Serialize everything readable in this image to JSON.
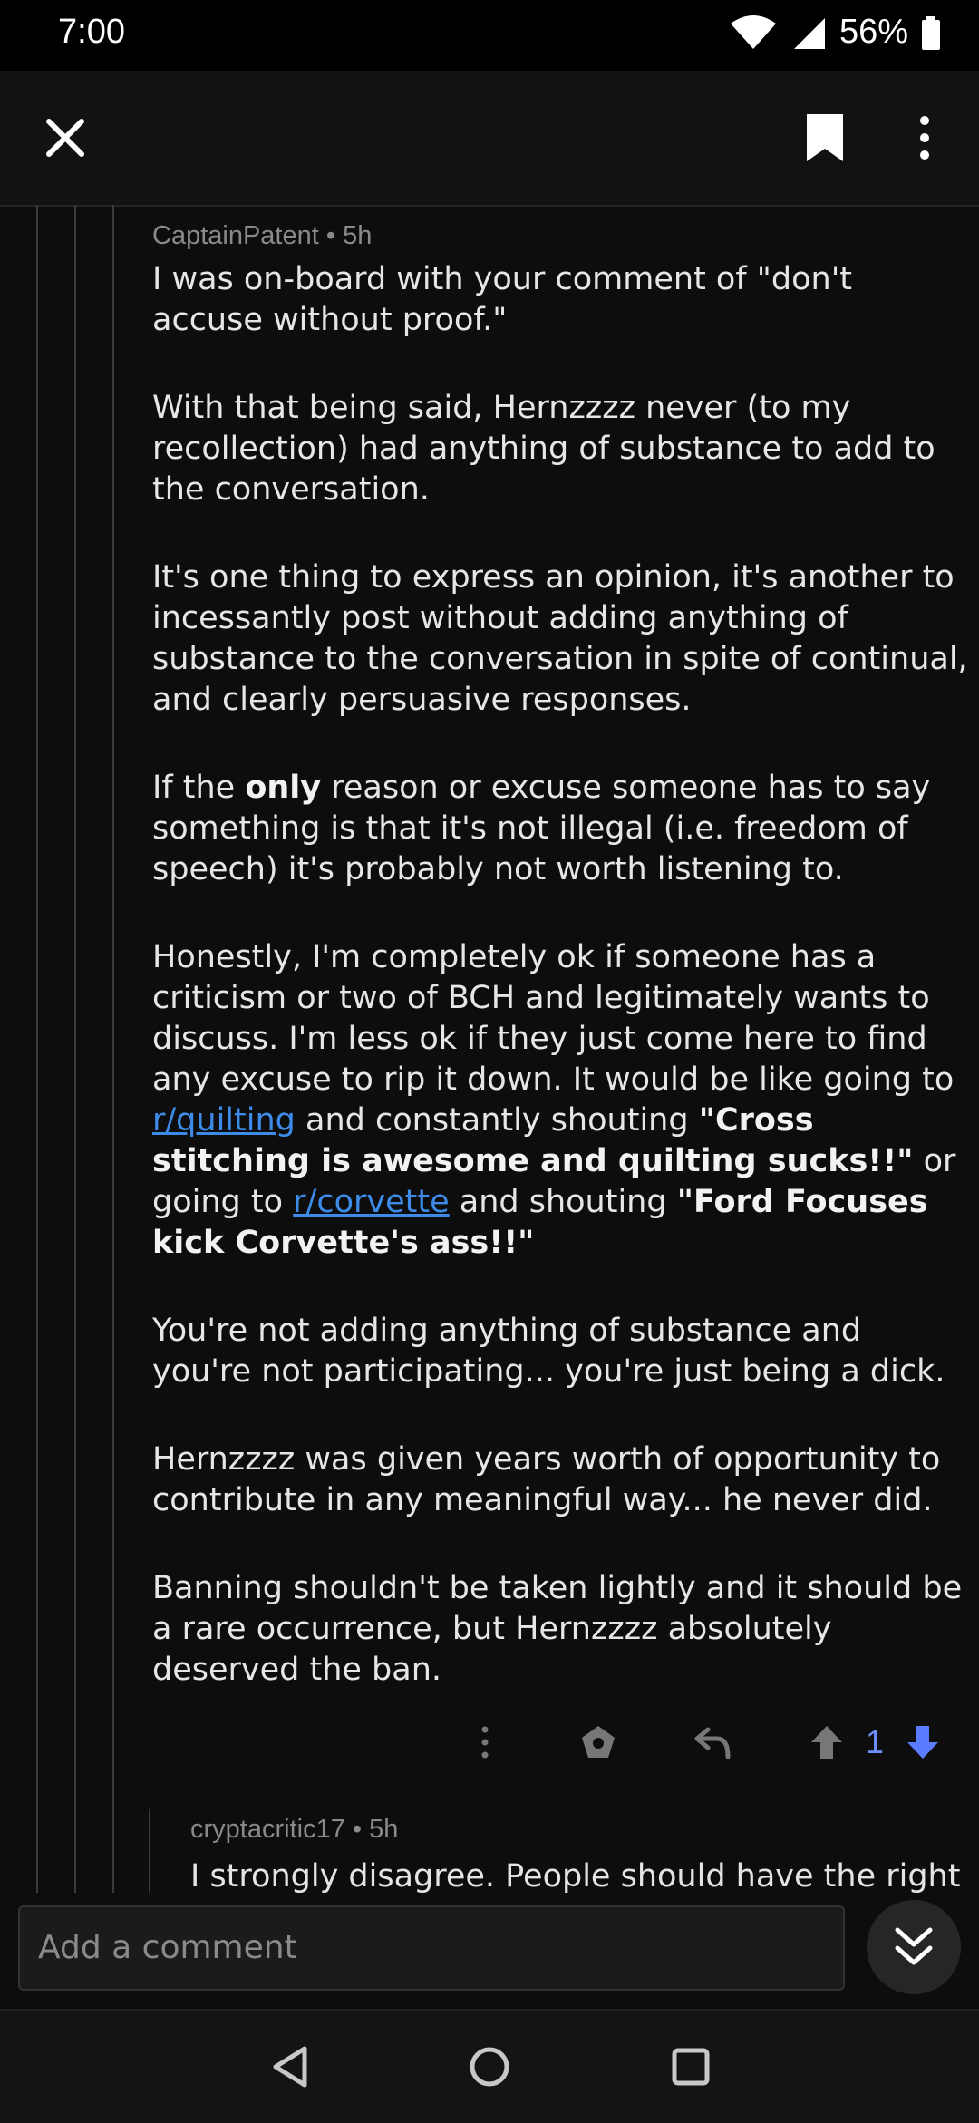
{
  "status_bar": {
    "time": "7:00",
    "battery": "56%"
  },
  "toolbar": {
    "close_icon": "close-icon",
    "bookmark_icon": "bookmark-icon",
    "more_icon": "more-vert-icon"
  },
  "comment": {
    "author": "CaptainPatent",
    "age": "• 5h",
    "p1": "I was on-board with your comment of \"don't accuse without proof.\"",
    "p2": "With that being said, Hernzzzz never (to my recollection) had anything of substance to add to the conversation.",
    "p3": "It's one thing to express an opinion, it's another to incessantly post without adding anything of substance to the conversation in spite of continual, and clearly persuasive responses.",
    "p4_a": "If the ",
    "p4_b": "only",
    "p4_c": " reason or excuse someone has to say something is that it's not illegal (i.e. freedom of speech) it's probably not worth listening to.",
    "p5_a": "Honestly, I'm completely ok if someone has a criticism or two of BCH and legitimately wants to discuss. I'm less ok if they just come here to find any excuse to rip it down. It would be like going to ",
    "p5_link1": "r/quilting",
    "p5_b": " and constantly shouting ",
    "p5_bold1": "\"Cross stitching is awesome and quilting sucks!!\"",
    "p5_c": " or going to ",
    "p5_link2": "r/corvette",
    "p5_d": " and shouting ",
    "p5_bold2": "\"Ford Focuses kick Corvette's ass!!\"",
    "p6": "You're not adding anything of substance and you're not participating... you're just being a dick.",
    "p7": "Hernzzzz was given years worth of opportunity to contribute in any meaningful way... he never did.",
    "p8": "Banning shouldn't be taken lightly and it should be a rare occurrence, but Hernzzzz absolutely deserved the ban.",
    "score": "1"
  },
  "reply": {
    "author": "cryptacritic17",
    "age": "• 5h",
    "text": "I strongly disagree. People should have the right"
  },
  "composer": {
    "placeholder": "Add a comment"
  },
  "colors": {
    "accent": "#6e8fff",
    "link": "#3d8be8",
    "background": "#0d0d0d"
  }
}
